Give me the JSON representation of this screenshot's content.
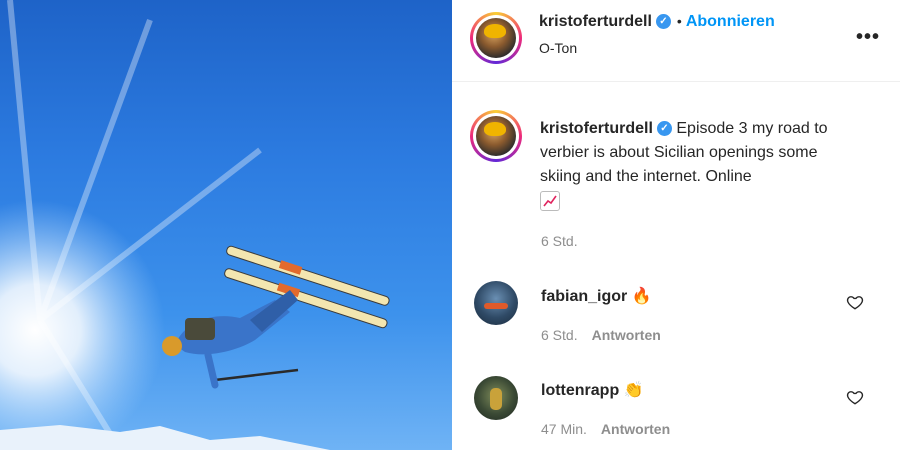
{
  "post": {
    "author": "kristoferturdell",
    "follow_label": "Abonnieren",
    "dot": "•",
    "subtitle": "O-Ton",
    "more": "•••"
  },
  "caption": {
    "author": "kristoferturdell",
    "text": "Episode 3 my road to verbier is about Sicilian openings some skiing and the internet. Online",
    "emoji_icon": "chart-increasing-icon",
    "time": "6 Std."
  },
  "comments": [
    {
      "user": "fabian_igor",
      "emoji": "🔥",
      "time": "6 Std.",
      "reply": "Antworten"
    },
    {
      "user": "lottenrapp",
      "emoji": "👏",
      "time": "47 Min.",
      "reply": "Antworten"
    }
  ],
  "colors": {
    "accent": "#0095f6",
    "verified": "#3897f0",
    "sky_top": "#1e63c8",
    "sky_bottom": "#6fb3f5"
  }
}
